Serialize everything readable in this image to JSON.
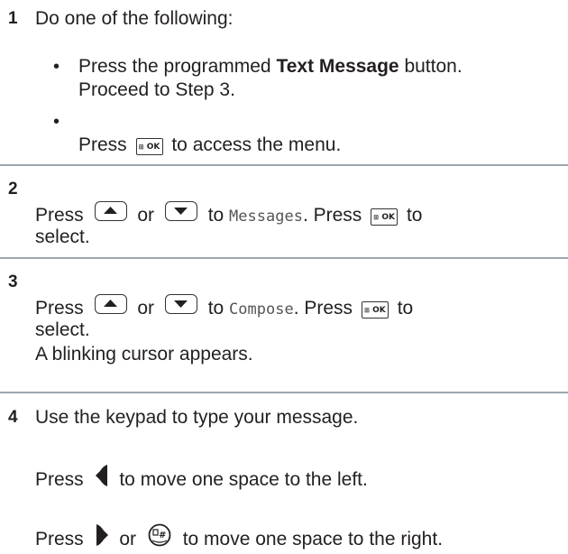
{
  "steps": [
    {
      "number": "1",
      "intro": "Do one of the following:",
      "bullets": [
        {
          "line1_pre": "Press the programmed ",
          "line1_bold": "Text Message",
          "line1_post": " button.",
          "line2": "Proceed to Step 3."
        },
        {
          "pre": "Press ",
          "post": " to access the menu."
        }
      ]
    },
    {
      "number": "2",
      "pre": "Press ",
      "or": " or ",
      "to": " to ",
      "menu_item": "Messages",
      "mid": ". Press ",
      "post": " to",
      "line2": "select."
    },
    {
      "number": "3",
      "pre": "Press ",
      "or": " or ",
      "to": " to ",
      "menu_item": "Compose",
      "mid": ". Press ",
      "post": " to",
      "line2": "select.",
      "line3": "A blinking cursor appears."
    },
    {
      "number": "4",
      "line1": "Use the keypad to type your message.",
      "left_pre": "Press ",
      "left_post": " to move one space to the left.",
      "right_pre": "Press ",
      "right_or": " or ",
      "right_post": " to move one space to the right."
    }
  ],
  "icons": {
    "menu_ok": "menu-ok-button-icon",
    "up": "up-navigation-button-icon",
    "down": "down-navigation-button-icon",
    "left": "left-arrow-icon",
    "right": "right-arrow-icon",
    "pound": "pound-key-icon"
  },
  "key_labels": {
    "menu_ok": "OK",
    "pound": "#"
  },
  "colors": {
    "text": "#231f20",
    "divider": "#9aa7b0"
  }
}
